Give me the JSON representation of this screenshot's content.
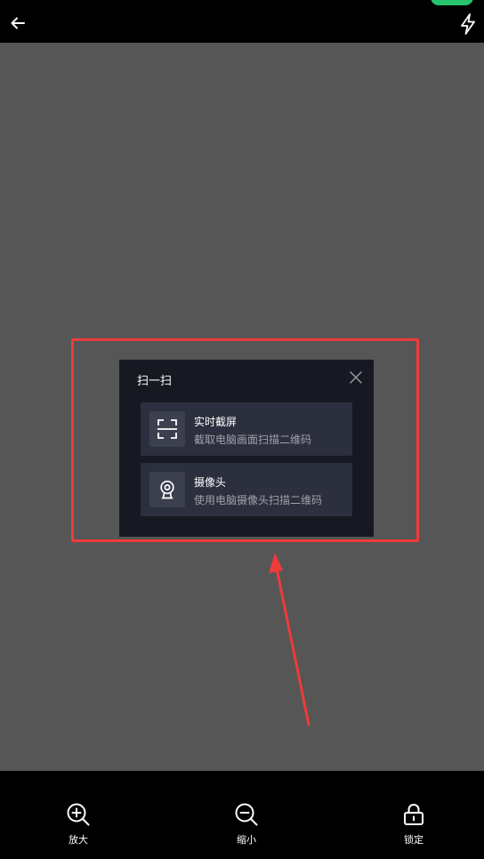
{
  "dialog": {
    "title": "扫一扫",
    "options": [
      {
        "title": "实时截屏",
        "description": "截取电脑画面扫描二维码",
        "icon": "scan-frame-icon"
      },
      {
        "title": "摄像头",
        "description": "使用电脑摄像头扫描二维码",
        "icon": "webcam-icon"
      }
    ]
  },
  "toolbar": {
    "zoom_in": "放大",
    "zoom_out": "缩小",
    "lock": "锁定"
  },
  "icons": {
    "back": "arrow-left-icon",
    "flash": "lightning-icon",
    "close": "close-icon",
    "zoom_in": "zoom-in-icon",
    "zoom_out": "zoom-out-icon",
    "lock": "lock-icon"
  },
  "colors": {
    "viewport_bg": "#565656",
    "dialog_bg": "#171922",
    "option_bg": "#2c2f3d",
    "highlight": "#ee3b3b",
    "status_pill": "#27c46d"
  }
}
